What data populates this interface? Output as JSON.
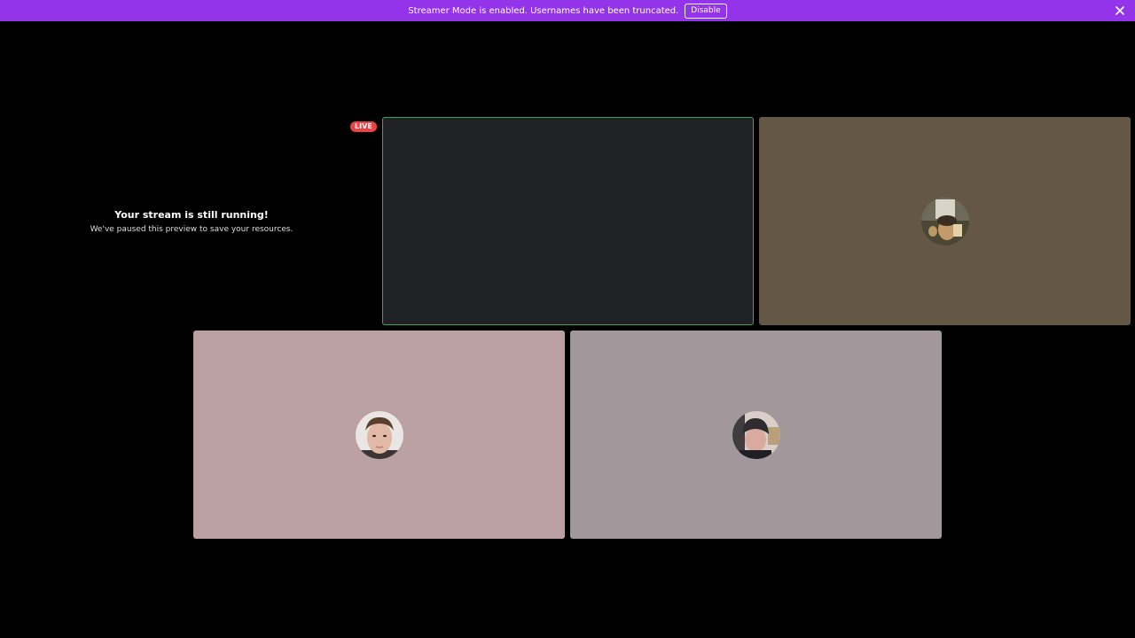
{
  "notice": {
    "message": "Streamer Mode is enabled. Usernames have been truncated.",
    "disable_label": "Disable",
    "close_icon": "close-icon",
    "background_color": "#9333ea"
  },
  "stream": {
    "title": "Your stream is still running!",
    "subtitle": "We've paused this preview to save your resources.",
    "live_label": "LIVE",
    "live_color": "#ed4245"
  },
  "participants": [
    {
      "tile": "own-stream-tile",
      "state": "preview-paused",
      "border_color": "#3ba55c",
      "background_color": "#202124"
    },
    {
      "tile": "participant-tile-1",
      "avatar_icon": "user-avatar",
      "background_color": "#645746"
    },
    {
      "tile": "participant-tile-2",
      "avatar_icon": "user-avatar",
      "background_color": "#bba0a3"
    },
    {
      "tile": "participant-tile-3",
      "avatar_icon": "user-avatar",
      "background_color": "#a2979a"
    }
  ]
}
